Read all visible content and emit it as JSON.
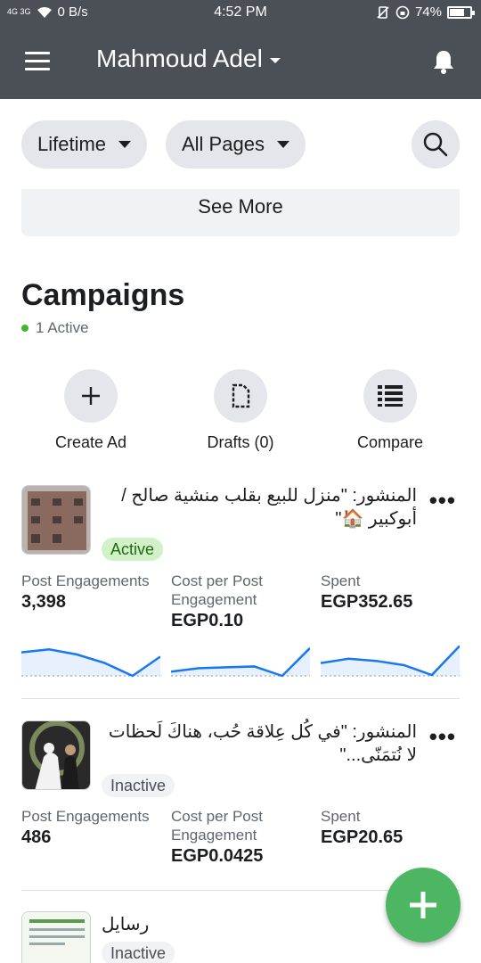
{
  "status_bar": {
    "network": "4G  3G",
    "data_rate": "0 B/s",
    "time": "4:52 PM",
    "battery": "74%",
    "battery_level": 0.74
  },
  "app_bar": {
    "account_name": "Mahmoud Adel",
    "menu_icon": "hamburger-icon",
    "notification_icon": "bell-icon"
  },
  "filters": {
    "date_range": "Lifetime",
    "pages": "All Pages",
    "search_icon": "search-icon"
  },
  "see_more": "See More",
  "campaigns": {
    "title": "Campaigns",
    "active_count": "1 Active",
    "active_dot_color": "#42b72a"
  },
  "actions": [
    {
      "label": "Create Ad",
      "icon": "plus-icon"
    },
    {
      "label": "Drafts (0)",
      "icon": "document-icon"
    },
    {
      "label": "Compare",
      "icon": "compare-list-icon"
    }
  ],
  "ads": [
    {
      "title": "المنشور: \"منزل للبيع بقلب منشية صالح / أبوكبير 🏠\"",
      "status": "Active",
      "metrics": [
        {
          "label": "Post Engagements",
          "value": "3,398",
          "trend": [
            0.55,
            0.62,
            0.5,
            0.3,
            0.0,
            0.45
          ]
        },
        {
          "label": "Cost per Post Engagement",
          "value": "EGP0.10",
          "trend": [
            0.1,
            0.18,
            0.2,
            0.22,
            0.0,
            0.65
          ]
        },
        {
          "label": "Spent",
          "value": "EGP352.65",
          "trend": [
            0.3,
            0.4,
            0.35,
            0.25,
            0.02,
            0.7
          ]
        }
      ]
    },
    {
      "title": "المنشور: \"في كُل عِلاقة حُب، هناكَ لَحظات لا نُتمَنّى...\"",
      "status": "Inactive",
      "metrics": [
        {
          "label": "Post Engagements",
          "value": "486"
        },
        {
          "label": "Cost per Post Engagement",
          "value": "EGP0.0425"
        },
        {
          "label": "Spent",
          "value": "EGP20.65"
        }
      ]
    },
    {
      "title": "رسايل",
      "status": "Inactive"
    }
  ],
  "fab_icon": "plus-icon",
  "accent_color": "#4cb663"
}
